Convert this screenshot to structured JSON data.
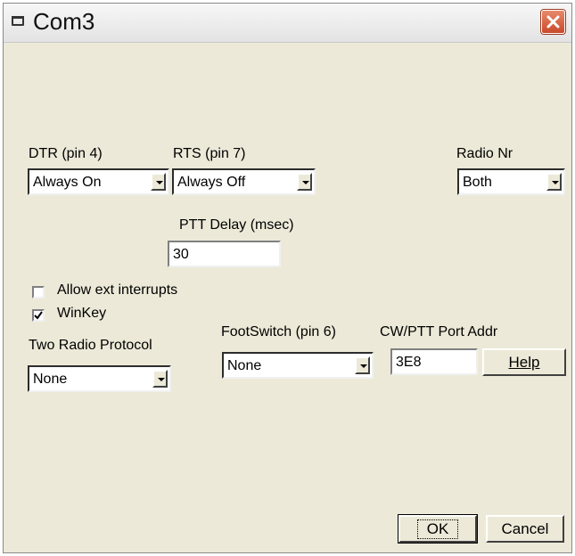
{
  "window": {
    "title": "Com3"
  },
  "dtr": {
    "label": "DTR (pin 4)",
    "value": "Always On"
  },
  "rts": {
    "label": "RTS (pin 7)",
    "value": "Always Off"
  },
  "radio_nr": {
    "label": "Radio Nr",
    "value": "Both"
  },
  "ptt_delay": {
    "label": "PTT Delay  (msec)",
    "value": "30"
  },
  "allow_ext_interrupts": {
    "label": "Allow ext interrupts",
    "checked": false
  },
  "winkey": {
    "label": "WinKey",
    "checked": true
  },
  "two_radio_protocol": {
    "label": "Two Radio Protocol",
    "value": "None"
  },
  "footswitch": {
    "label": "FootSwitch (pin 6)",
    "value": "None"
  },
  "cw_ptt_port": {
    "label": "CW/PTT Port Addr",
    "value": "3E8"
  },
  "buttons": {
    "help": "Help",
    "ok": "OK",
    "cancel": "Cancel"
  }
}
